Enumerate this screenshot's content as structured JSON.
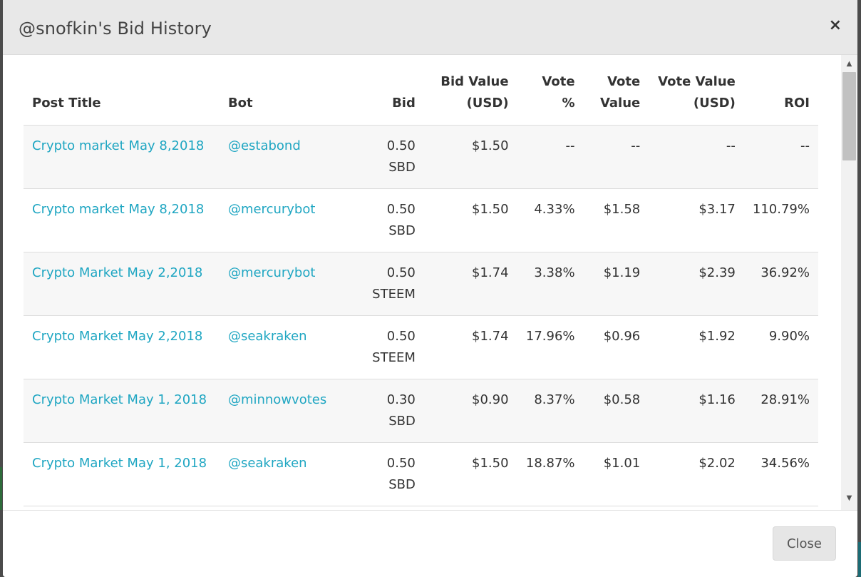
{
  "modal": {
    "title": "@snofkin's Bid History",
    "close_icon": "×",
    "footer_close_label": "Close"
  },
  "table": {
    "headers": {
      "post_title": "Post Title",
      "bot": "Bot",
      "bid": "Bid",
      "bid_value_1": "Bid Value",
      "bid_value_2": "(USD)",
      "vote_pct": "Vote %",
      "vote_value_1": "Vote",
      "vote_value_2": "Value",
      "vote_value_usd_1": "Vote Value",
      "vote_value_usd_2": "(USD)",
      "roi": "ROI"
    },
    "rows": [
      {
        "title": "Crypto market May 8,2018",
        "bot": "@estabond",
        "bid_amount": "0.50",
        "bid_currency": "SBD",
        "bid_value": "$1.50",
        "vote_pct": "--",
        "vote_value": "--",
        "vote_value_usd": "--",
        "roi": "--"
      },
      {
        "title": "Crypto market May 8,2018",
        "bot": "@mercurybot",
        "bid_amount": "0.50",
        "bid_currency": "SBD",
        "bid_value": "$1.50",
        "vote_pct": "4.33%",
        "vote_value": "$1.58",
        "vote_value_usd": "$3.17",
        "roi": "110.79%"
      },
      {
        "title": "Crypto Market May 2,2018",
        "bot": "@mercurybot",
        "bid_amount": "0.50",
        "bid_currency": "STEEM",
        "bid_value": "$1.74",
        "vote_pct": "3.38%",
        "vote_value": "$1.19",
        "vote_value_usd": "$2.39",
        "roi": "36.92%"
      },
      {
        "title": "Crypto Market May 2,2018",
        "bot": "@seakraken",
        "bid_amount": "0.50",
        "bid_currency": "STEEM",
        "bid_value": "$1.74",
        "vote_pct": "17.96%",
        "vote_value": "$0.96",
        "vote_value_usd": "$1.92",
        "roi": "9.90%"
      },
      {
        "title": "Crypto Market May 1, 2018",
        "bot": "@minnowvotes",
        "bid_amount": "0.30",
        "bid_currency": "SBD",
        "bid_value": "$0.90",
        "vote_pct": "8.37%",
        "vote_value": "$0.58",
        "vote_value_usd": "$1.16",
        "roi": "28.91%"
      },
      {
        "title": "Crypto Market May 1, 2018",
        "bot": "@seakraken",
        "bid_amount": "0.50",
        "bid_currency": "SBD",
        "bid_value": "$1.50",
        "vote_pct": "18.87%",
        "vote_value": "$1.01",
        "vote_value_usd": "$2.02",
        "roi": "34.56%"
      }
    ]
  },
  "scrollbar": {
    "up_icon": "▲",
    "down_icon": "▼"
  }
}
